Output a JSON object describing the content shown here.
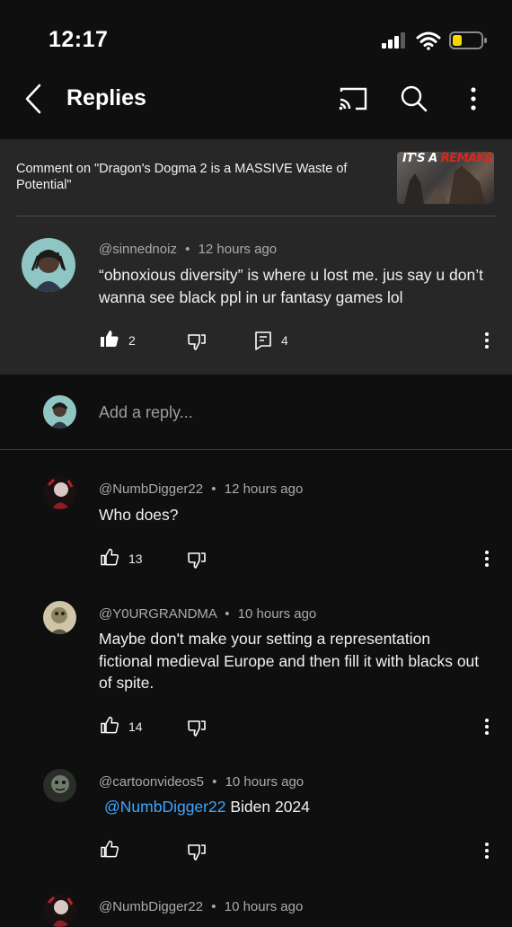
{
  "status_bar": {
    "time": "12:17"
  },
  "header": {
    "title": "Replies"
  },
  "context": {
    "text": "Comment on \"Dragon's Dogma 2 is a MASSIVE Waste of Potential\"",
    "thumbnail_text_1": "IT'S A ",
    "thumbnail_text_2": "REMAKE"
  },
  "parent": {
    "handle": "@sinnednoiz",
    "time": "12 hours ago",
    "text": "“obnoxious diversity” is where u lost me. jus say u don’t wanna see black ppl in ur fantasy games lol",
    "likes": "2",
    "replies": "4"
  },
  "add_reply": {
    "placeholder": "Add a reply..."
  },
  "replies": [
    {
      "handle": "@NumbDigger22",
      "time": "12 hours ago",
      "text": "Who does?",
      "likes": "13"
    },
    {
      "handle": "@Y0URGRANDMA",
      "time": "10 hours ago",
      "text": "Maybe don't make your setting a representation fictional medieval Europe and then fill it with blacks out of spite.",
      "likes": "14"
    },
    {
      "handle": "@cartoonvideos5",
      "time": "10 hours ago",
      "mention": "@NumbDigger22",
      "text": "Biden 2024",
      "likes": ""
    },
    {
      "handle": "@NumbDigger22",
      "time": "10 hours ago"
    }
  ],
  "separator": "•"
}
